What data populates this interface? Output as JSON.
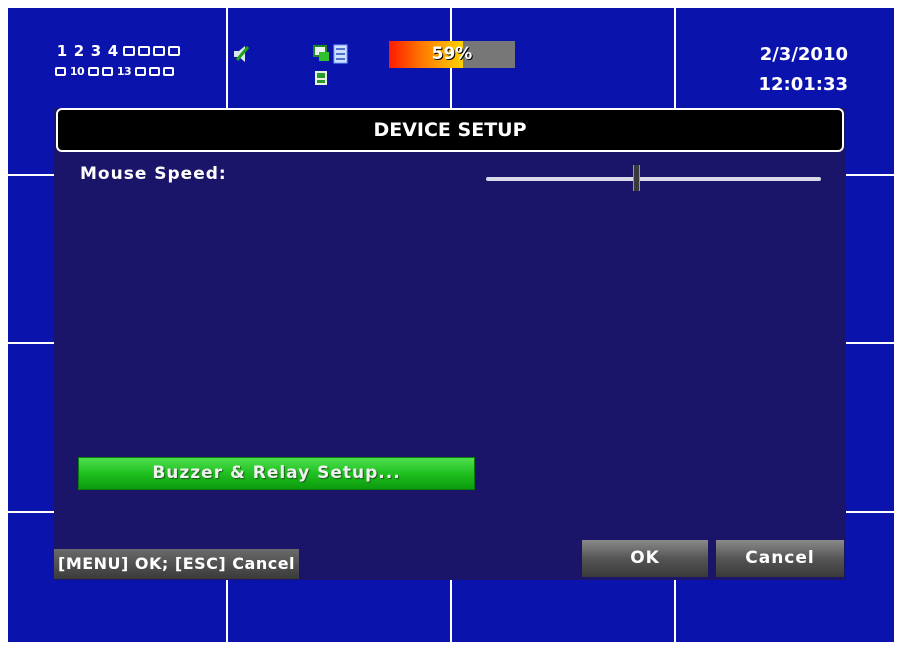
{
  "status_bar": {
    "channels_row1": [
      "1",
      "2",
      "3",
      "4"
    ],
    "channels_row2": [
      "10",
      "13"
    ],
    "hdd_usage_label": "59%",
    "hdd_usage_fraction": 0.59,
    "date": "2/3/2010",
    "time": "12:01:33",
    "icons": [
      "audio-icon",
      "network-icon",
      "record-icon",
      "disk-icon"
    ]
  },
  "dialog": {
    "title": "DEVICE SETUP",
    "mouse_speed_label": "Mouse Speed:",
    "mouse_speed_fraction": 0.44,
    "buzzer_button_label": "Buzzer & Relay Setup...",
    "hint": "[MENU] OK; [ESC] Cancel",
    "ok_label": "OK",
    "cancel_label": "Cancel"
  },
  "colors": {
    "screen_background": "#0b13ad",
    "dialog_background": "#1b156a",
    "accent_green": "#20c020"
  }
}
